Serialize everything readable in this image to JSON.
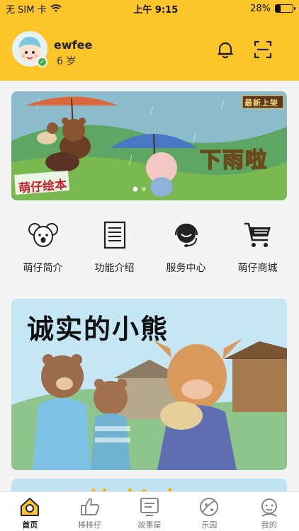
{
  "status_bar": {
    "carrier": "无 SIM 卡",
    "time": "上午 9:15",
    "battery_text": "28%",
    "battery_level": 0.28
  },
  "profile": {
    "username": "ewfee",
    "age": "6 岁"
  },
  "header_icons": [
    "bell-icon",
    "scan-icon"
  ],
  "banner": {
    "badge": "最新上架",
    "title": "下雨啦",
    "brand": "萌仔绘本",
    "dots": 2,
    "active_dot": 0
  },
  "quick_menu": [
    {
      "label": "萌仔简介",
      "icon": "koala-icon"
    },
    {
      "label": "功能介绍",
      "icon": "document-icon"
    },
    {
      "label": "服务中心",
      "icon": "headset-icon"
    },
    {
      "label": "萌仔商城",
      "icon": "cart-icon"
    }
  ],
  "story_card": {
    "title": "诚实的小熊"
  },
  "next_card": {
    "title": "口钩长点"
  },
  "tab_bar": [
    {
      "label": "首页",
      "icon": "home-icon",
      "active": true
    },
    {
      "label": "棒棒仔",
      "icon": "thumbs-up-icon",
      "active": false
    },
    {
      "label": "故事屋",
      "icon": "story-icon",
      "active": false
    },
    {
      "label": "乐园",
      "icon": "park-icon",
      "active": false
    },
    {
      "label": "我的",
      "icon": "profile-icon",
      "active": false
    }
  ],
  "colors": {
    "brand_yellow": "#fcc62b",
    "badge_green": "#3fae4a",
    "story_title_color": "#111111"
  }
}
